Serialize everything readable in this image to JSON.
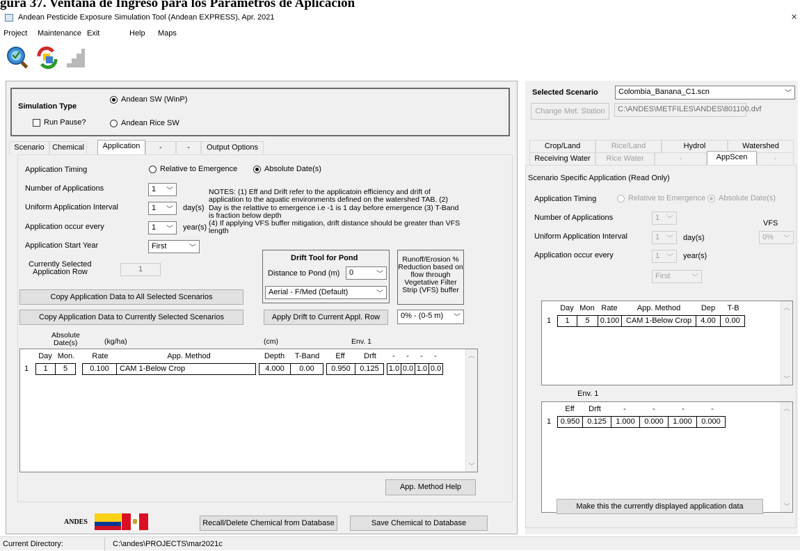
{
  "caption": "gura 37.  Ventana de Ingreso para los Parámetros de Aplicación",
  "window": {
    "title": "Andean Pesticide Exposure Simulation Tool (Andean EXPRESS), Apr. 2021",
    "close": "×"
  },
  "menu": {
    "project": "Project",
    "maintenance": "Maintenance",
    "exit": "Exit",
    "help": "Help",
    "maps": "Maps"
  },
  "simulation": {
    "title": "Simulation Type",
    "run_pause": "Run Pause?",
    "opt_sw": "Andean SW (WinP)",
    "opt_rice": "Andean Rice SW"
  },
  "left_tabs": [
    "Scenario",
    "Chemical",
    "Application",
    "-",
    "-",
    "Output Options"
  ],
  "app": {
    "timing_label": "Application Timing",
    "timing_relative": "Relative to Emergence",
    "timing_absolute": "Absolute Date(s)",
    "num_apps_label": "Number of Applications",
    "num_apps_value": "1",
    "interval_label": "Uniform Application Interval",
    "interval_value": "1",
    "interval_unit": "day(s)",
    "every_label": "Application occur every",
    "every_value": "1",
    "every_unit": "year(s)",
    "start_year_label": "Application Start Year",
    "start_year_value": "First",
    "selected_row_label_1": "Currently Selected",
    "selected_row_label_2": "Application Row",
    "selected_row_value": "1",
    "notes": [
      "NOTES: (1) Eff and Drift refer to the applicatoin efficiency and drift of",
      "application to the aquatic environments defined on the watershed TAB. (2)",
      "Day is the relattive to emergence i.e -1 is 1 day before emergence (3) T-Band",
      "is fraction below depth",
      "(4) If applying VFS buffer mitigation, drift distance should be greater than VFS",
      "length"
    ],
    "copy_all_btn": "Copy Application Data to All Selected Scenarios",
    "copy_current_btn": "Copy Application Data to Currently Selected Scenarios",
    "drift_title": "Drift Tool for Pond",
    "distance_label": "Distance to Pond (m)",
    "distance_value": "0",
    "drift_method": "Aerial - F/Med (Default)",
    "apply_drift_btn": "Apply Drift to Current Appl. Row",
    "runoff_text": [
      "Runoff/Erosion %",
      "Reduction based on",
      "flow through",
      "Vegetative Filter",
      "Strip (VFS) buffer"
    ],
    "runoff_value": "0% - (0-5 m)",
    "grid_top_labels": {
      "abs1": "Absolute",
      "abs2": "Date(s)",
      "kgha": "(kg/ha)",
      "cm": "(cm)",
      "env": "Env. 1"
    },
    "grid_headers": [
      "Day",
      "Mon.",
      "Rate",
      "App. Method",
      "Depth",
      "T-Band",
      "Eff",
      "Drft",
      "-",
      "-",
      "-",
      "-"
    ],
    "grid_rows": [
      {
        "index": "1",
        "cells": [
          "1",
          "5",
          "0.100",
          "CAM 1-Below Crop",
          "4.000",
          "0.00",
          "0.950",
          "0.125",
          "1.0",
          "0.0",
          "1.0",
          "0.0"
        ]
      }
    ],
    "method_help_btn": "App. Method Help"
  },
  "bottom": {
    "logo_text": "ANDES",
    "recall_btn": "Recall/Delete Chemical from Database",
    "save_btn": "Save Chemical to Database"
  },
  "status": {
    "label": "Current Directory:",
    "value": "C:\\andes\\PROJECTS\\mar2021c"
  },
  "scenario": {
    "label": "Selected Scenario",
    "value": "Colombia_Banana_C1.scn",
    "change_met_btn": "Change Met. Station",
    "met_path": "C:\\ANDES\\METFILES\\ANDES\\801100.dvf"
  },
  "right_tabs_row1": [
    "Crop/Land",
    "Rice/Land",
    "Hydrol",
    "Watershed"
  ],
  "right_tabs_row2": [
    "Receiving Water",
    "Rice Water",
    "-",
    "AppScen",
    "-"
  ],
  "appscen": {
    "title": "Scenario Specific Application (Read Only)",
    "timing_label": "Application Timing",
    "timing_relative": "Relative to Emergence",
    "timing_absolute": "Absolute Date(s)",
    "num_apps_label": "Number of Applications",
    "num_apps_value": "1",
    "interval_label": "Uniform Application Interval",
    "interval_value": "1",
    "interval_unit": "day(s)",
    "every_label": "Application occur every",
    "every_value": "1",
    "every_unit": "year(s)",
    "start_value": "First",
    "vfs_label": "VFS",
    "vfs_value": "0%",
    "grid1_headers": [
      "Day",
      "Mon",
      "Rate",
      "App. Method",
      "Dep",
      "T-B"
    ],
    "grid1_row": {
      "index": "1",
      "cells": [
        "1",
        "5",
        "0.100",
        "CAM 1-Below Crop",
        "4.00",
        "0.00"
      ]
    },
    "env_label": "Env. 1",
    "grid2_headers": [
      "Eff",
      "Drft",
      "-",
      "-",
      "-",
      "-"
    ],
    "grid2_row": {
      "index": "1",
      "cells": [
        "0.950",
        "0.125",
        "1.000",
        "0.000",
        "1.000",
        "0.000"
      ]
    },
    "make_current_btn": "Make this the currently displayed application data"
  }
}
